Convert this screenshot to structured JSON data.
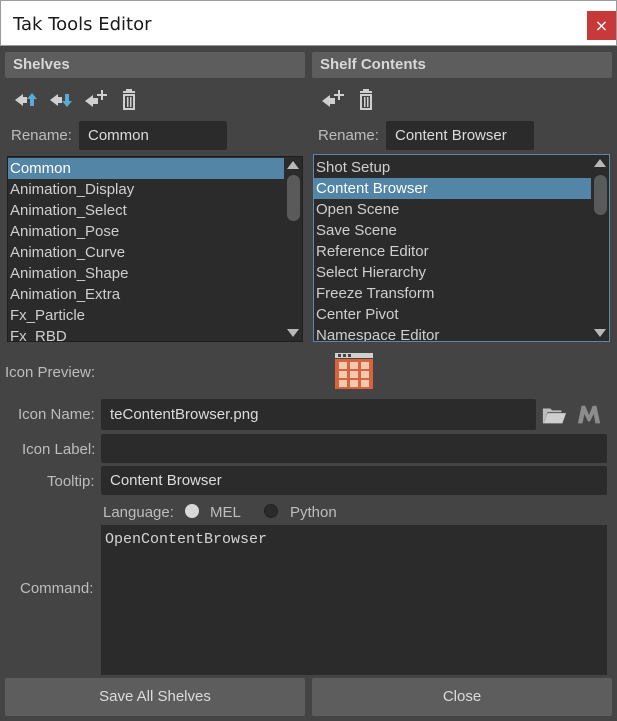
{
  "window": {
    "title": "Tak Tools Editor",
    "close_glyph": "×"
  },
  "shelves": {
    "header": "Shelves",
    "toolbar": [
      "move-up-icon",
      "move-down-icon",
      "add-icon",
      "trash-icon"
    ],
    "rename_label": "Rename:",
    "rename_value": "Common",
    "items": [
      "Common",
      "Animation_Display",
      "Animation_Select",
      "Animation_Pose",
      "Animation_Curve",
      "Animation_Shape",
      "Animation_Extra",
      "Fx_Particle",
      "Fx_RBD"
    ],
    "selected": "Common"
  },
  "contents": {
    "header": "Shelf Contents",
    "toolbar": [
      "add-icon",
      "trash-icon"
    ],
    "rename_label": "Rename:",
    "rename_value": "Content Browser",
    "items": [
      "Shot Setup",
      "Content Browser",
      "Open Scene",
      "Save Scene",
      "Reference Editor",
      "Select Hierarchy",
      "Freeze Transform",
      "Center Pivot",
      "Namespace Editor"
    ],
    "selected": "Content Browser"
  },
  "editor": {
    "icon_preview_label": "Icon Preview:",
    "icon_name_label": "Icon Name:",
    "icon_name_value": "teContentBrowser.png",
    "icon_label_label": "Icon Label:",
    "icon_label_value": "",
    "tooltip_label": "Tooltip:",
    "tooltip_value": "Content Browser",
    "language_label": "Language:",
    "lang_mel": "MEL",
    "lang_python": "Python",
    "language_selected": "MEL",
    "command_label": "Command:",
    "command_value": "OpenContentBrowser"
  },
  "buttons": {
    "save_all": "Save All Shelves",
    "close": "Close"
  },
  "colors": {
    "bg": "#444444",
    "header": "#5d5d5d",
    "field": "#2b2b2b",
    "selection": "#5285a6",
    "close_red": "#c83a3a",
    "icon_orange": "#d7643c"
  }
}
